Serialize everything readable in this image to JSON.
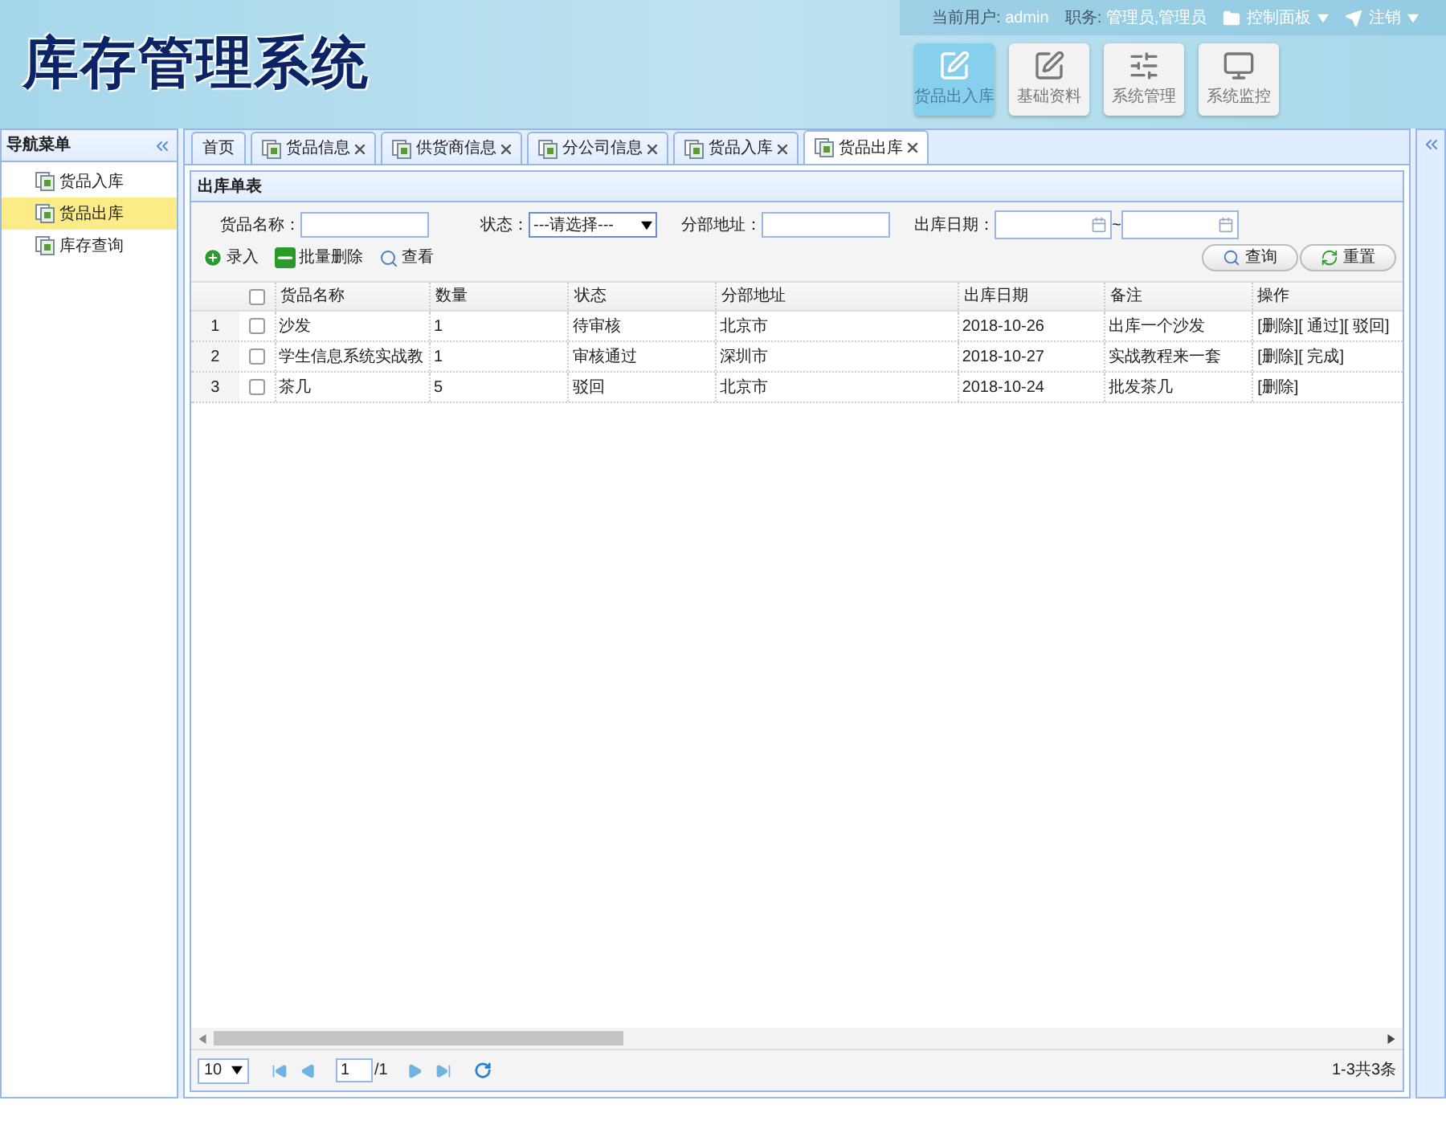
{
  "header": {
    "title": "库存管理系统",
    "user_label": "当前用户:",
    "user": "admin",
    "role_label": "职务:",
    "role": "管理员,管理员",
    "menus": [
      "控制面板",
      "注销"
    ],
    "nav": [
      {
        "label": "货品出入库",
        "kind": "edit",
        "selected": true
      },
      {
        "label": "基础资料",
        "kind": "edit",
        "selected": false
      },
      {
        "label": "系统管理",
        "kind": "sliders",
        "selected": false
      },
      {
        "label": "系统监控",
        "kind": "monitor",
        "selected": false
      }
    ]
  },
  "sidebar": {
    "title": "导航菜单",
    "items": [
      {
        "label": "货品入库",
        "selected": false
      },
      {
        "label": "货品出库",
        "selected": true
      },
      {
        "label": "库存查询",
        "selected": false
      }
    ]
  },
  "tabs": [
    {
      "label": "首页",
      "closable": false,
      "selected": false
    },
    {
      "label": "货品信息",
      "closable": true,
      "selected": false
    },
    {
      "label": "供货商信息",
      "closable": true,
      "selected": false
    },
    {
      "label": "分公司信息",
      "closable": true,
      "selected": false
    },
    {
      "label": "货品入库",
      "closable": true,
      "selected": false
    },
    {
      "label": "货品出库",
      "closable": true,
      "selected": true
    }
  ],
  "panel_title": "出库单表",
  "filters": {
    "name_label": "货品名称：",
    "status_label": "状态：",
    "status_value": "---请选择---",
    "address_label": "分部地址：",
    "date_label": "出库日期：",
    "date_sep": "~"
  },
  "toolbar": [
    "录入",
    "批量删除",
    "查看"
  ],
  "buttons": [
    "查询",
    "重置"
  ],
  "table": {
    "all_checked": false,
    "columns": [
      "货品名称",
      "数量",
      "状态",
      "分部地址",
      "出库日期",
      "备注",
      "操作"
    ],
    "rows": [
      {
        "index": "1",
        "checked": false,
        "cells": [
          "沙发",
          "1",
          "待审核",
          "北京市",
          "2018-10-26",
          "出库一个沙发"
        ],
        "actions": [
          "[删除]",
          "[ 通过]",
          "[ 驳回]"
        ]
      },
      {
        "index": "2",
        "checked": false,
        "cells": [
          "学生信息系统实战教",
          "1",
          "审核通过",
          "深圳市",
          "2018-10-27",
          "实战教程来一套"
        ],
        "actions": [
          "[删除]",
          "[ 完成]"
        ]
      },
      {
        "index": "3",
        "checked": false,
        "cells": [
          "茶几",
          "5",
          "驳回",
          "北京市",
          "2018-10-24",
          "批发茶几"
        ],
        "actions": [
          "[删除]"
        ]
      }
    ]
  },
  "pager": {
    "page_size": "10",
    "page": "1",
    "pages": "/1",
    "summary": "1-3共3条"
  }
}
